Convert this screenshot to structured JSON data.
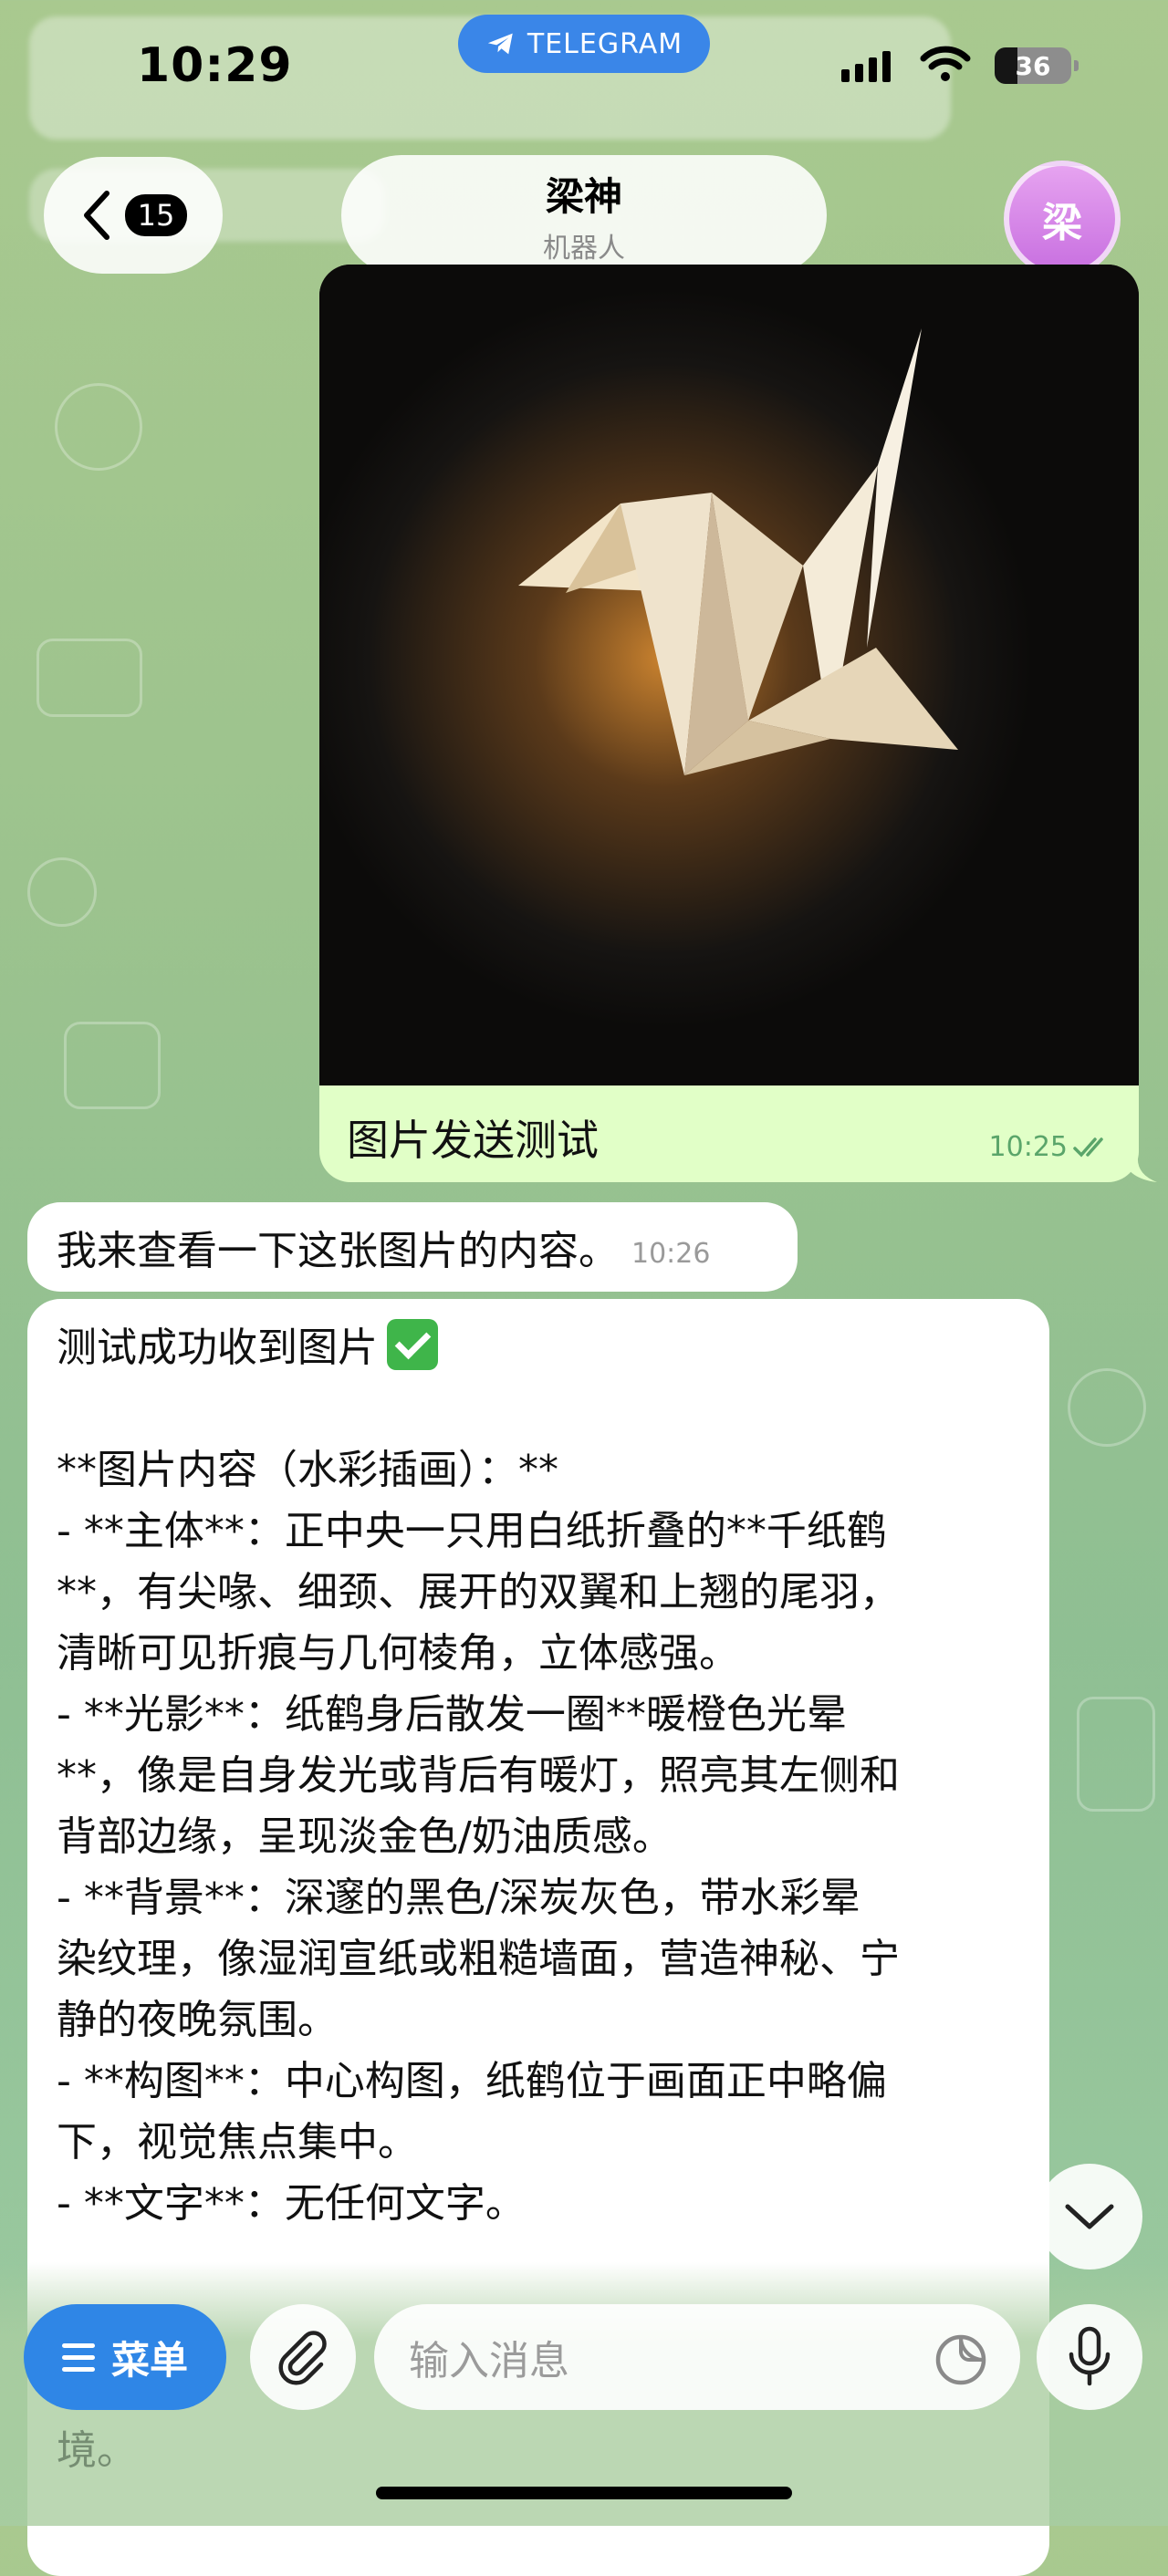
{
  "status_bar": {
    "time": "10:29",
    "app_pill": "TELEGRAM",
    "battery": "36"
  },
  "header": {
    "back_count": "15",
    "chat_name": "梁神",
    "chat_subtitle": "机器人",
    "avatar_letter": "梁"
  },
  "messages": {
    "outgoing_photo": {
      "caption": "图片发送测试",
      "time": "10:25",
      "status": "read"
    },
    "incoming_1": {
      "text": "我来查看一下这张图片的内容。",
      "time": "10:26"
    },
    "incoming_2": {
      "lines": [
        "测试成功收到图片",
        "",
        "**图片内容（水彩插画）：**",
        "- **主体**：正中央一只用白纸折叠的**千纸鹤",
        "**，有尖喙、细颈、展开的双翼和上翘的尾羽，",
        "清晰可见折痕与几何棱角，立体感强。",
        "- **光影**：纸鹤身后散发一圈**暖橙色光晕",
        "**，像是自身发光或背后有暖灯，照亮其左侧和",
        "背部边缘，呈现淡金色/奶油质感。",
        "- **背景**：深邃的黑色/深炭灰色，带水彩晕",
        "染纹理，像湿润宣纸或粗糙墙面，营造神秘、宁",
        "静的夜晚氛围。",
        "- **构图**：中心构图，纸鹤位于画面正中略偏",
        "下，视觉焦点集中。",
        "- **文字**：无任何文字。"
      ],
      "trailing_text": "境。"
    }
  },
  "input_bar": {
    "menu_label": "菜单",
    "placeholder": "输入消息"
  },
  "colors": {
    "accent": "#2f86e6",
    "outgoing_bubble": "#e1ffc7",
    "incoming_bubble": "#ffffff"
  }
}
